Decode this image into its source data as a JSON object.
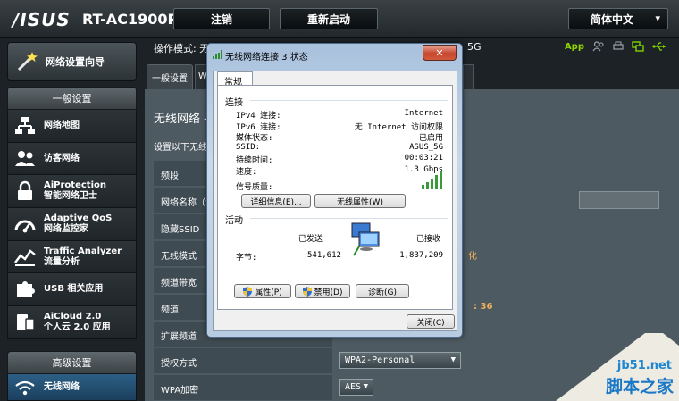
{
  "header": {
    "logo": "/ISUS",
    "model": "RT-AC1900P",
    "logout_label": "注销",
    "reboot_label": "重新启动",
    "language": "简体中文"
  },
  "sidebar": {
    "wizard_label": "网络设置向导",
    "general_header": "一般设置",
    "general_items": [
      {
        "line1": "网络地图",
        "line2": "",
        "icon": "network-map-icon"
      },
      {
        "line1": "访客网络",
        "line2": "",
        "icon": "guest-network-icon"
      },
      {
        "line1": "AiProtection",
        "line2": "智能网络卫士",
        "icon": "aiprotection-lock-icon"
      },
      {
        "line1": "Adaptive QoS",
        "line2": "网络监控家",
        "icon": "qos-gauge-icon"
      },
      {
        "line1": "Traffic Analyzer",
        "line2": "流量分析",
        "icon": "traffic-analyzer-icon"
      },
      {
        "line1": "USB 相关应用",
        "line2": "",
        "icon": "usb-puzzle-icon"
      },
      {
        "line1": "AiCloud 2.0",
        "line2": "个人云 2.0 应用",
        "icon": "aicloud-icon"
      }
    ],
    "advanced_header": "高级设置",
    "advanced_items": [
      {
        "line1": "无线网络",
        "icon": "wireless-icon"
      }
    ]
  },
  "main": {
    "opmode_text": "操作模式: 无",
    "ssid_hint": "5G",
    "status_app": "App",
    "tab_general": "一般设置",
    "tab_second": "W",
    "panel_title": "无线网络 -",
    "panel_sub": "设置以下无线",
    "rows": [
      {
        "label": "频段"
      },
      {
        "label": "网络名称（S"
      },
      {
        "label": "隐藏SSID"
      },
      {
        "label": "无线模式"
      },
      {
        "label": "频道带宽"
      },
      {
        "label": "频道"
      },
      {
        "label": "扩展频道"
      },
      {
        "label": "授权方式"
      },
      {
        "label": "WPA加密"
      }
    ],
    "wireless_mode_note": "化",
    "channel_note": ": 36",
    "auth_method": "WPA2-Personal",
    "wpa_encryption": "AES"
  },
  "dialog": {
    "title": "无线网络连接 3 状态",
    "tab": "常规",
    "connection_group": "连接",
    "fields": [
      {
        "key": "IPv4 连接:",
        "value": "Internet"
      },
      {
        "key": "IPv6 连接:",
        "value": "无 Internet 访问权限"
      },
      {
        "key": "媒体状态:",
        "value": "已启用"
      },
      {
        "key": "SSID:",
        "value": "ASUS_5G"
      },
      {
        "key": "持续时间:",
        "value": "00:03:21"
      },
      {
        "key": "速度:",
        "value": "1.3 Gbps"
      }
    ],
    "signal_label": "信号质量:",
    "details_btn": "详细信息(E)...",
    "wireless_props_btn": "无线属性(W)",
    "activity_group": "活动",
    "sent_label": "已发送",
    "received_label": "已接收",
    "bytes_label": "字节:",
    "bytes_sent": "541,612",
    "bytes_received": "1,837,209",
    "properties_btn": "属性(P)",
    "disable_btn": "禁用(D)",
    "diagnose_btn": "诊断(G)",
    "close_btn": "关闭(C)"
  },
  "watermark": {
    "url": "jb51.net",
    "cn": "脚本之家"
  }
}
